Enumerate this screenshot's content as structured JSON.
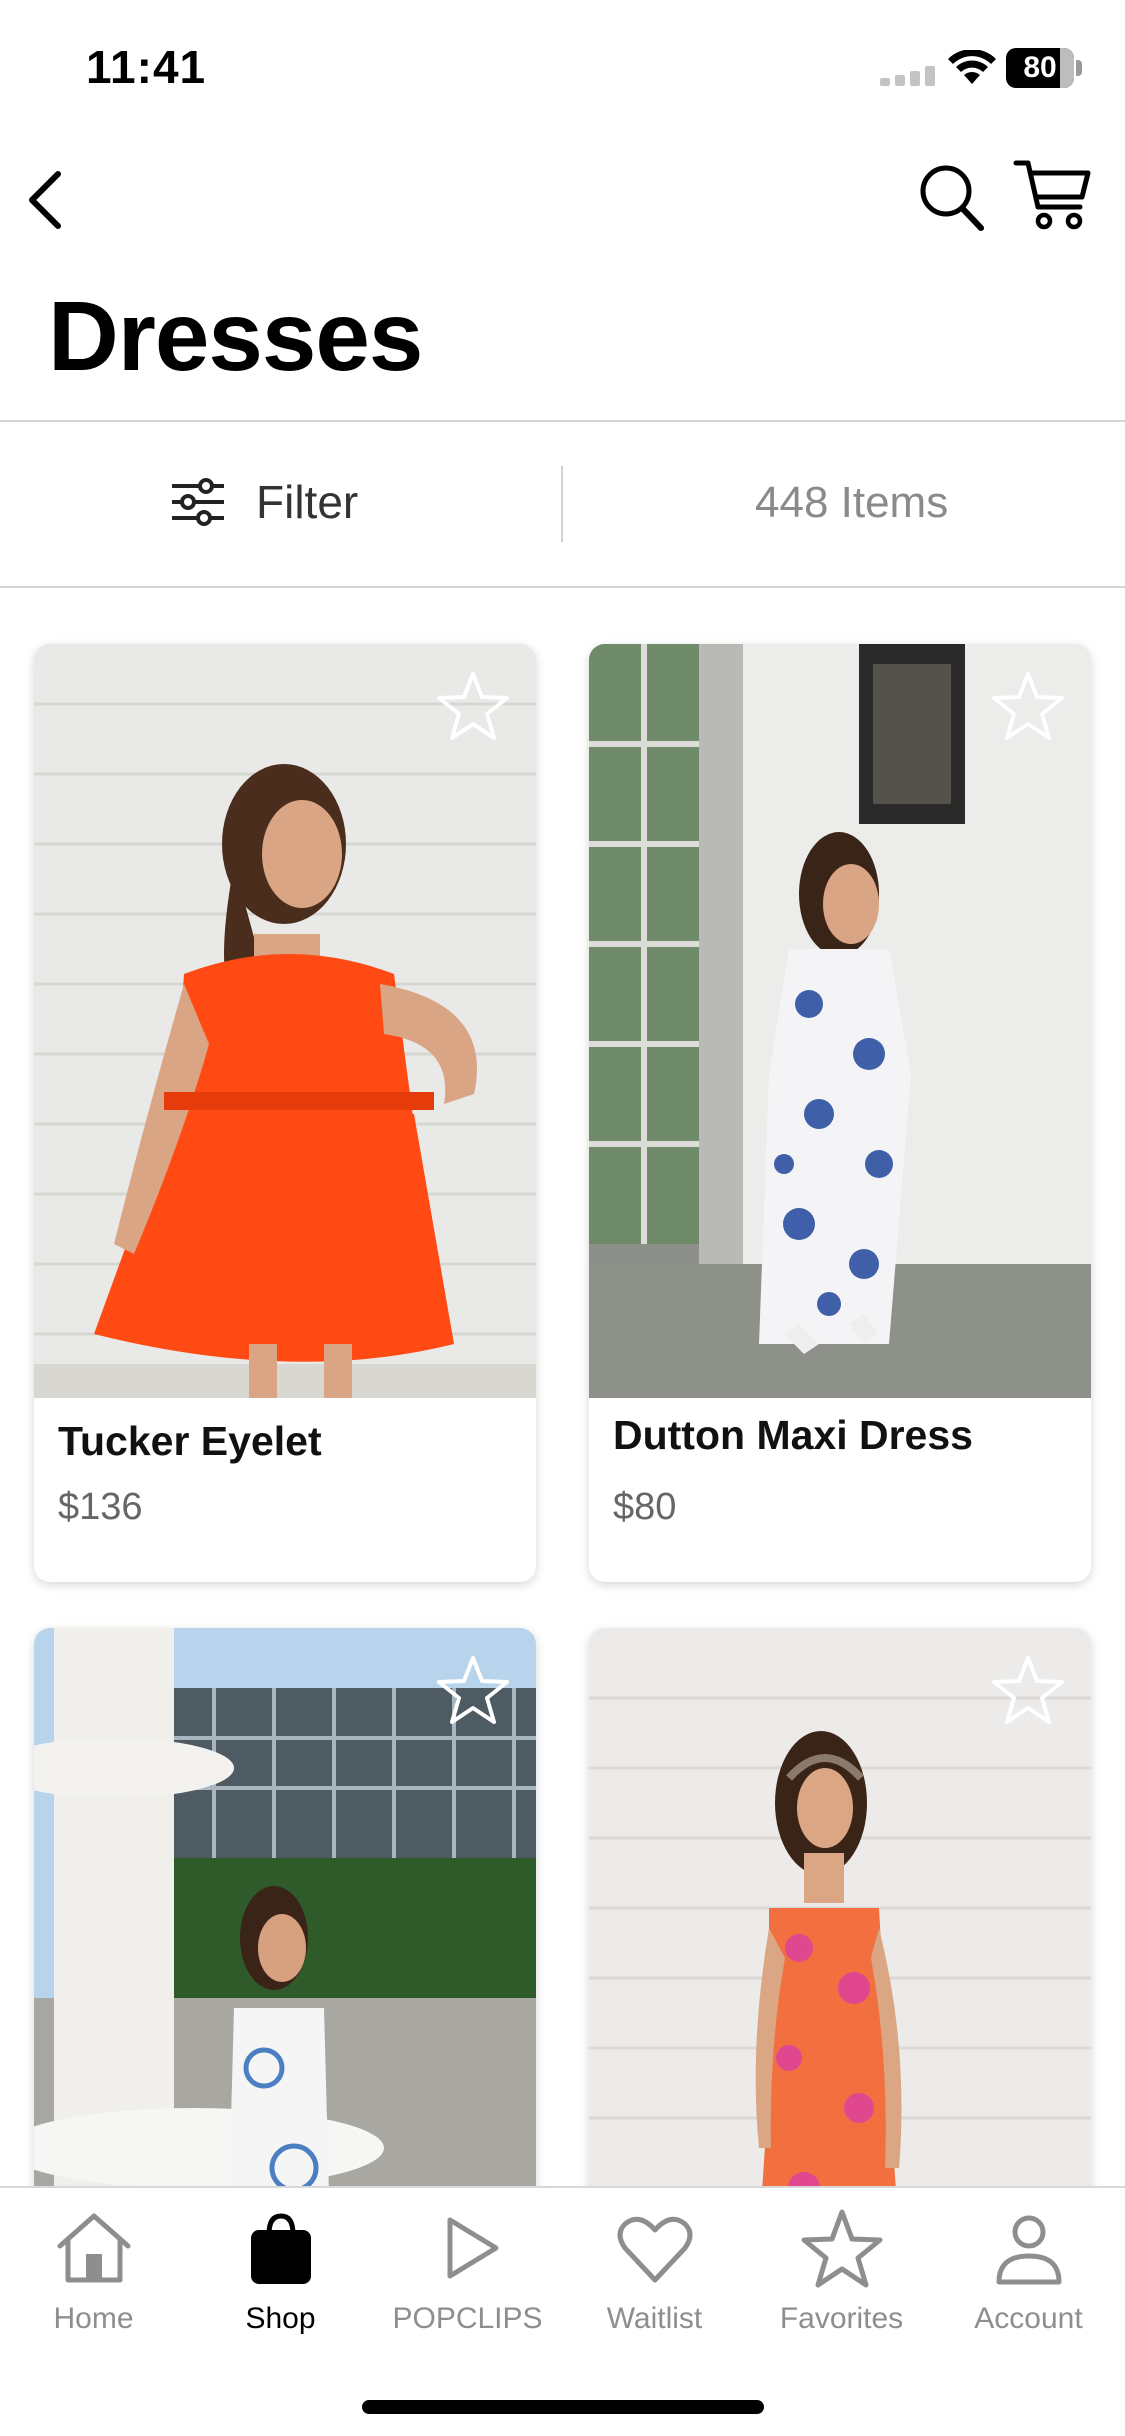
{
  "status_bar": {
    "time": "11:41",
    "battery": "80",
    "battery_level": 0.8
  },
  "page": {
    "title": "Dresses"
  },
  "filter": {
    "label": "Filter",
    "items_count": "448 Items"
  },
  "products": [
    {
      "name": "Tucker Eyelet",
      "price": "$136",
      "dress_color": "#ff4a14",
      "favorited": false
    },
    {
      "name": "Dutton Maxi Dress",
      "price": "$80",
      "dress_color": "#3f5fa8",
      "favorited": false
    },
    {
      "name": "",
      "price": "",
      "dress_color": "#4c7fc2",
      "favorited": false
    },
    {
      "name": "",
      "price": "",
      "dress_color": "#f27040",
      "favorited": false
    }
  ],
  "tabs": [
    {
      "label": "Home",
      "icon": "home-icon",
      "active": false
    },
    {
      "label": "Shop",
      "icon": "shopping-bag-icon",
      "active": true
    },
    {
      "label": "POPCLIPS",
      "icon": "play-icon",
      "active": false
    },
    {
      "label": "Waitlist",
      "icon": "heart-icon",
      "active": false
    },
    {
      "label": "Favorites",
      "icon": "star-icon",
      "active": false
    },
    {
      "label": "Account",
      "icon": "person-icon",
      "active": false
    }
  ],
  "colors": {
    "text": "#000000",
    "muted": "#8e8e8e",
    "divider": "#d4d4d4",
    "price": "#666666"
  }
}
